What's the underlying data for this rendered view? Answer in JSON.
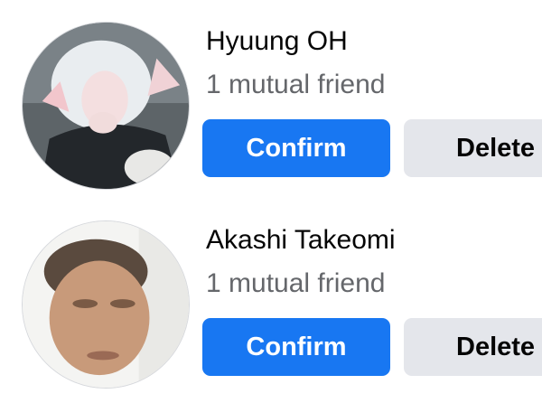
{
  "friend_requests": [
    {
      "name": "Hyuung OH",
      "mutual": "1 mutual friend",
      "confirm_label": "Confirm",
      "delete_label": "Delete"
    },
    {
      "name": "Akashi Takeomi",
      "mutual": "1 mutual friend",
      "confirm_label": "Confirm",
      "delete_label": "Delete"
    }
  ],
  "colors": {
    "confirm_bg": "#1877f2",
    "delete_bg": "#e4e6eb",
    "name_text": "#050505",
    "secondary_text": "#65676b"
  }
}
